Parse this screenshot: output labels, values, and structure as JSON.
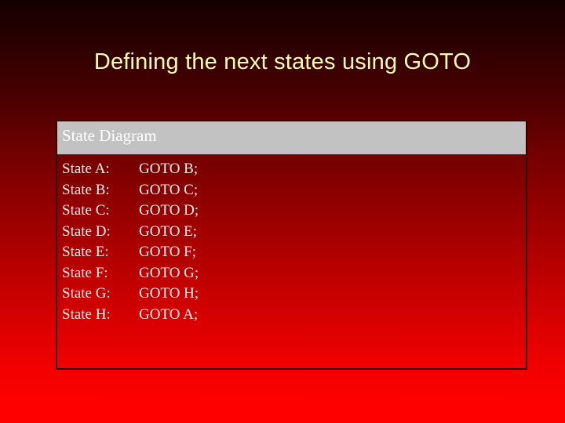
{
  "slide": {
    "title": "Defining the next states using GOTO",
    "title_color": "#ffffaa",
    "background_top_color": "#140000",
    "background_bottom_color": "#ff0000"
  },
  "content_box": {
    "header": {
      "label": "State Diagram",
      "background_color": "#c2c2c2",
      "text_color": "#ffffff"
    },
    "border_color": "#2a0303",
    "body_text_color": "#f2f2f2",
    "rows": [
      {
        "state": "State  A:",
        "goto": "GOTO B;"
      },
      {
        "state": "State B:",
        "goto": "GOTO C;"
      },
      {
        "state": "State C:",
        "goto": "GOTO D;"
      },
      {
        "state": "State D:",
        "goto": "GOTO E;"
      },
      {
        "state": "State E:",
        "goto": "GOTO F;"
      },
      {
        "state": "State F:",
        "goto": "GOTO G;"
      },
      {
        "state": "State G:",
        "goto": "GOTO H;"
      },
      {
        "state": "State H:",
        "goto": "GOTO A;"
      }
    ]
  }
}
